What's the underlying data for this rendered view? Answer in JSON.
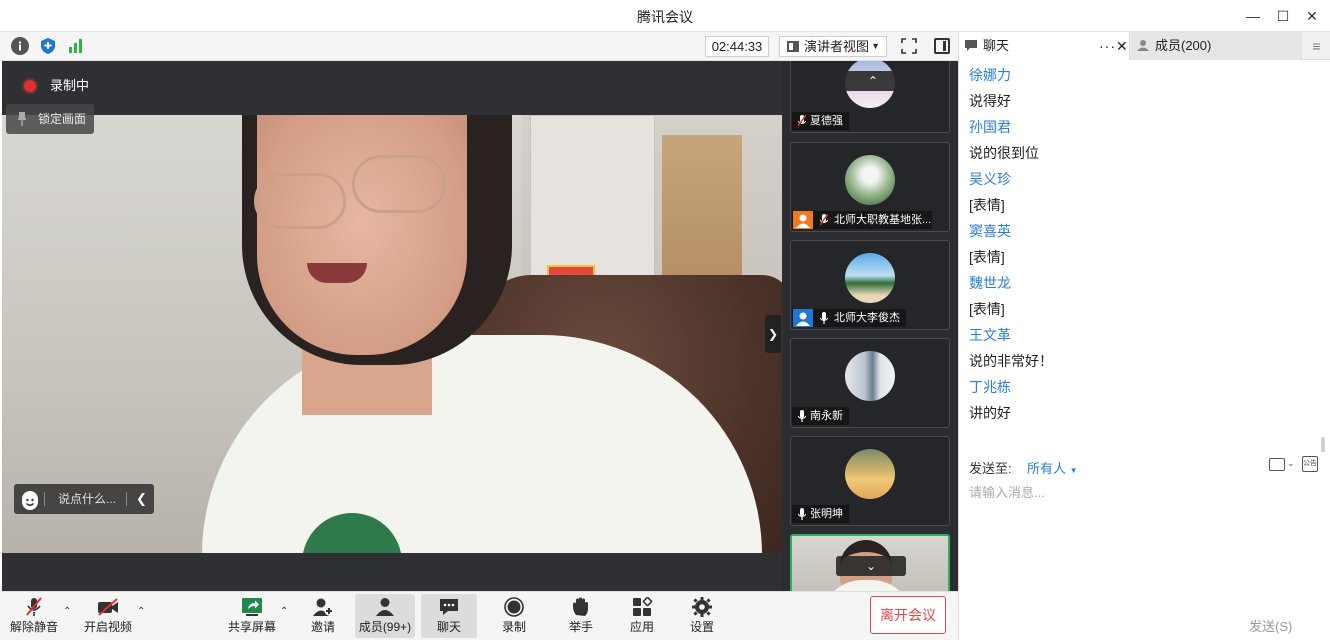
{
  "window": {
    "title": "腾讯会议"
  },
  "toolbar": {
    "timer": "02:44:33",
    "view_mode": "演讲者视图"
  },
  "stage": {
    "recording_label": "录制中",
    "lock_view_label": "锁定画面",
    "quick_chat_placeholder": "说点什么..."
  },
  "participants": [
    {
      "name": "夏德强",
      "mic": "muted"
    },
    {
      "name": "北师大职教基地张...",
      "mic": "muted",
      "badge": "user"
    },
    {
      "name": "北师大李俊杰",
      "mic": "on",
      "badge": "user"
    },
    {
      "name": "南永新",
      "mic": "on"
    },
    {
      "name": "张明坤",
      "mic": "on"
    }
  ],
  "bottombar": {
    "unmute": "解除静音",
    "start_video": "开启视频",
    "share_screen": "共享屏幕",
    "invite": "邀请",
    "members": "成员(99+)",
    "chat": "聊天",
    "record": "录制",
    "raise_hand": "举手",
    "apps": "应用",
    "settings": "设置",
    "leave": "离开会议"
  },
  "panel": {
    "tab_chat": "聊天",
    "tab_members": "成员(200)",
    "messages": [
      {
        "sender": "徐娜力",
        "text": "说得好"
      },
      {
        "sender": "孙国君",
        "text": "说的很到位"
      },
      {
        "sender": "吴义珍",
        "text": "[表情]"
      },
      {
        "sender": "窦喜英",
        "text": "[表情]"
      },
      {
        "sender": "魏世龙",
        "text": "[表情]"
      },
      {
        "sender": "王文革",
        "text": "说的非常好！"
      },
      {
        "sender": "丁兆栋",
        "text": "讲的好"
      }
    ],
    "send_to_label": "发送至:",
    "send_to_value": "所有人",
    "notice_icon_text": "公告",
    "input_placeholder": "请输入消息...",
    "send_button": "发送(S)"
  },
  "colors": {
    "accent": "#2a7de1",
    "leave": "#e04848",
    "recording": "#e03131"
  }
}
